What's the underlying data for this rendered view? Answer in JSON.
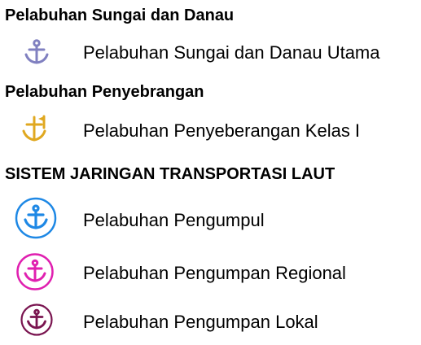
{
  "legend": {
    "section_river": {
      "heading": "Pelabuhan Sungai dan Danau",
      "items": [
        {
          "label": "Pelabuhan Sungai dan Danau Utama",
          "icon": "anchor-icon",
          "color": "#8080c0"
        }
      ]
    },
    "section_ferry": {
      "heading": "Pelabuhan Penyebrangan",
      "items": [
        {
          "label": "Pelabuhan Penyeberangan Kelas I",
          "icon": "anchor-flag-icon",
          "color": "#e0a820"
        }
      ]
    },
    "section_sea": {
      "heading": "SISTEM JARINGAN TRANSPORTASI LAUT",
      "items": [
        {
          "label": "Pelabuhan Pengumpul",
          "icon": "anchor-circle-icon",
          "color": "#1e88e5"
        },
        {
          "label": "Pelabuhan Pengumpan Regional",
          "icon": "anchor-circle-icon",
          "color": "#e020b0"
        },
        {
          "label": "Pelabuhan Pengumpan Lokal",
          "icon": "anchor-circle-icon",
          "color": "#7a1550"
        }
      ]
    }
  }
}
